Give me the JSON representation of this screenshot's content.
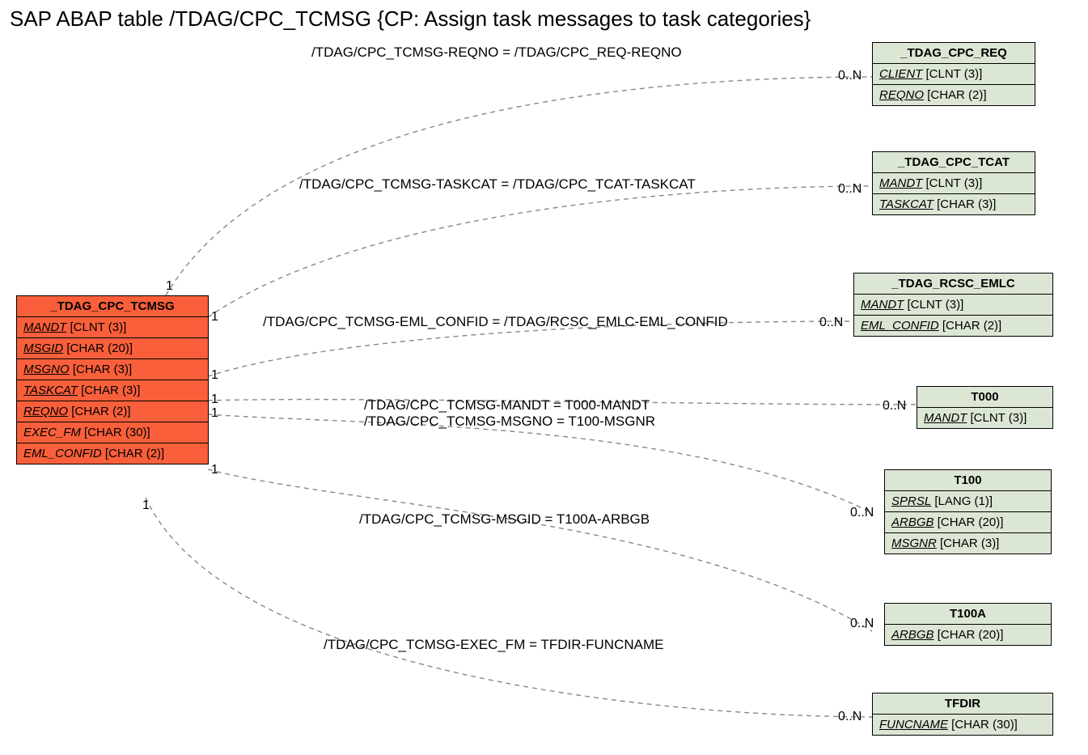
{
  "title": "SAP ABAP table /TDAG/CPC_TCMSG {CP: Assign task messages to task categories}",
  "mainEntity": {
    "name": "_TDAG_CPC_TCMSG",
    "fields": [
      {
        "name": "MANDT",
        "type": "[CLNT (3)]",
        "underline": true
      },
      {
        "name": "MSGID",
        "type": "[CHAR (20)]",
        "underline": true
      },
      {
        "name": "MSGNO",
        "type": "[CHAR (3)]",
        "underline": true
      },
      {
        "name": "TASKCAT",
        "type": "[CHAR (3)]",
        "underline": true
      },
      {
        "name": "REQNO",
        "type": "[CHAR (2)]",
        "underline": true
      },
      {
        "name": "EXEC_FM",
        "type": "[CHAR (30)]",
        "underline": false
      },
      {
        "name": "EML_CONFID",
        "type": "[CHAR (2)]",
        "underline": false
      }
    ]
  },
  "related": [
    {
      "name": "_TDAG_CPC_REQ",
      "fields": [
        {
          "name": "CLIENT",
          "type": "[CLNT (3)]",
          "underline": true
        },
        {
          "name": "REQNO",
          "type": "[CHAR (2)]",
          "underline": true
        }
      ]
    },
    {
      "name": "_TDAG_CPC_TCAT",
      "fields": [
        {
          "name": "MANDT",
          "type": "[CLNT (3)]",
          "underline": true
        },
        {
          "name": "TASKCAT",
          "type": "[CHAR (3)]",
          "underline": true
        }
      ]
    },
    {
      "name": "_TDAG_RCSC_EMLC",
      "fields": [
        {
          "name": "MANDT",
          "type": "[CLNT (3)]",
          "underline": true
        },
        {
          "name": "EML_CONFID",
          "type": "[CHAR (2)]",
          "underline": true
        }
      ]
    },
    {
      "name": "T000",
      "fields": [
        {
          "name": "MANDT",
          "type": "[CLNT (3)]",
          "underline": true
        }
      ]
    },
    {
      "name": "T100",
      "fields": [
        {
          "name": "SPRSL",
          "type": "[LANG (1)]",
          "underline": true
        },
        {
          "name": "ARBGB",
          "type": "[CHAR (20)]",
          "underline": true
        },
        {
          "name": "MSGNR",
          "type": "[CHAR (3)]",
          "underline": true
        }
      ]
    },
    {
      "name": "T100A",
      "fields": [
        {
          "name": "ARBGB",
          "type": "[CHAR (20)]",
          "underline": true
        }
      ]
    },
    {
      "name": "TFDIR",
      "fields": [
        {
          "name": "FUNCNAME",
          "type": "[CHAR (30)]",
          "underline": true
        }
      ]
    }
  ],
  "relations": [
    {
      "label": "/TDAG/CPC_TCMSG-REQNO = /TDAG/CPC_REQ-REQNO",
      "left": "1",
      "right": "0..N"
    },
    {
      "label": "/TDAG/CPC_TCMSG-TASKCAT = /TDAG/CPC_TCAT-TASKCAT",
      "left": "1",
      "right": "0..N"
    },
    {
      "label": "/TDAG/CPC_TCMSG-EML_CONFID = /TDAG/RCSC_EMLC-EML_CONFID",
      "left": "1",
      "right": "0..N"
    },
    {
      "label1": "/TDAG/CPC_TCMSG-MANDT = T000-MANDT",
      "label2": "/TDAG/CPC_TCMSG-MSGNO = T100-MSGNR",
      "left1": "1",
      "left2": "1",
      "right": "0..N"
    },
    {
      "label": "/TDAG/CPC_TCMSG-MSGID = T100A-ARBGB",
      "left": "1",
      "right": "0..N"
    },
    {
      "label": "/TDAG/CPC_TCMSG-EXEC_FM = TFDIR-FUNCNAME",
      "left": "1",
      "right": "0..N"
    },
    {
      "right": "0..N"
    }
  ]
}
